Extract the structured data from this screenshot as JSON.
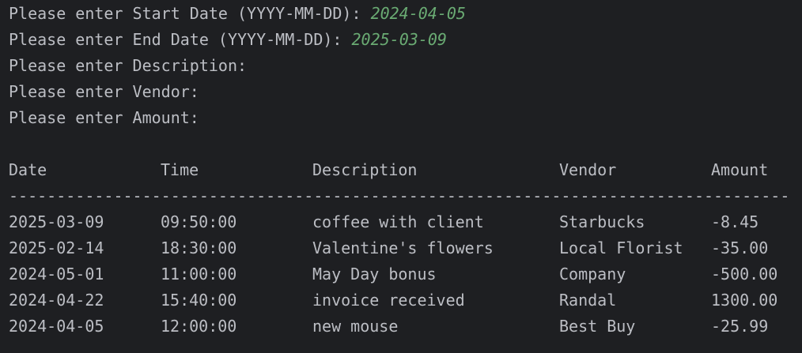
{
  "prompts": [
    {
      "label": "Please enter Start Date (YYYY-MM-DD): ",
      "value": "2024-04-05"
    },
    {
      "label": "Please enter End Date (YYYY-MM-DD): ",
      "value": "2025-03-09"
    },
    {
      "label": "Please enter Description: ",
      "value": ""
    },
    {
      "label": "Please enter Vendor: ",
      "value": ""
    },
    {
      "label": "Please enter Amount: ",
      "value": ""
    }
  ],
  "table": {
    "headers": [
      "Date",
      "Time",
      "Description",
      "Vendor",
      "Amount"
    ],
    "separator": "--------------------------------------------------------------------------------------------------",
    "rows": [
      [
        "2025-03-09",
        "09:50:00",
        "coffee with client",
        "Starbucks",
        "-8.45"
      ],
      [
        "2025-02-14",
        "18:30:00",
        "Valentine's flowers",
        "Local Florist",
        "-35.00"
      ],
      [
        "2024-05-01",
        "11:00:00",
        "May Day bonus",
        "Company",
        "-500.00"
      ],
      [
        "2024-04-22",
        "15:40:00",
        "invoice received",
        "Randal",
        "1300.00"
      ],
      [
        "2024-04-05",
        "12:00:00",
        "new mouse",
        "Best Buy",
        "-25.99"
      ]
    ]
  },
  "colors": {
    "background": "#1e1f22",
    "text": "#bcbec4",
    "user_input": "#6aab73"
  }
}
